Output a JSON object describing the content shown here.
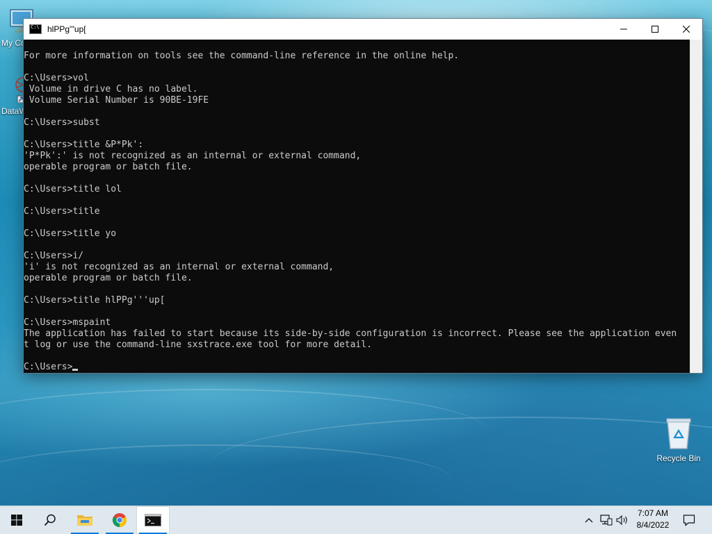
{
  "desktop": {
    "icons": [
      {
        "label": "My Co"
      },
      {
        "label": "DataW"
      },
      {
        "label": "Recycle Bin"
      }
    ]
  },
  "console": {
    "title": "hlPPg'''up[",
    "controls": {
      "minimize": "–",
      "maximize": "□",
      "close": "✕"
    },
    "lines": [
      "For more information on tools see the command-line reference in the online help.",
      "",
      "C:\\Users>vol",
      " Volume in drive C has no label.",
      " Volume Serial Number is 90BE-19FE",
      "",
      "C:\\Users>subst",
      "",
      "C:\\Users>title &P*Pk':",
      "'P*Pk':' is not recognized as an internal or external command,",
      "operable program or batch file.",
      "",
      "C:\\Users>title lol",
      "",
      "C:\\Users>title",
      "",
      "C:\\Users>title yo",
      "",
      "C:\\Users>i/",
      "'i' is not recognized as an internal or external command,",
      "operable program or batch file.",
      "",
      "C:\\Users>title hlPPg'''up[",
      "",
      "C:\\Users>mspaint",
      "The application has failed to start because its side-by-side configuration is incorrect. Please see the application even",
      "t log or use the command-line sxstrace.exe tool for more detail.",
      ""
    ],
    "prompt": "C:\\Users>"
  },
  "taskbar": {
    "items": [
      {
        "name": "Start",
        "icon": "windows-logo-icon"
      },
      {
        "name": "Search",
        "icon": "search-icon"
      },
      {
        "name": "File Explorer",
        "icon": "folder-icon"
      },
      {
        "name": "Google Chrome",
        "icon": "chrome-icon"
      },
      {
        "name": "Command Prompt",
        "icon": "cmd-icon"
      }
    ],
    "tray": {
      "icons": [
        "chevron-up-icon",
        "network-icon",
        "volume-icon",
        "notification-icon"
      ]
    },
    "clock": {
      "time": "7:07 AM",
      "date": "8/4/2022"
    }
  },
  "colors": {
    "console_bg": "#0c0c0c",
    "console_text": "#cccccc",
    "taskbar_bg": "#dfe8ee",
    "accent": "#0078d7"
  }
}
